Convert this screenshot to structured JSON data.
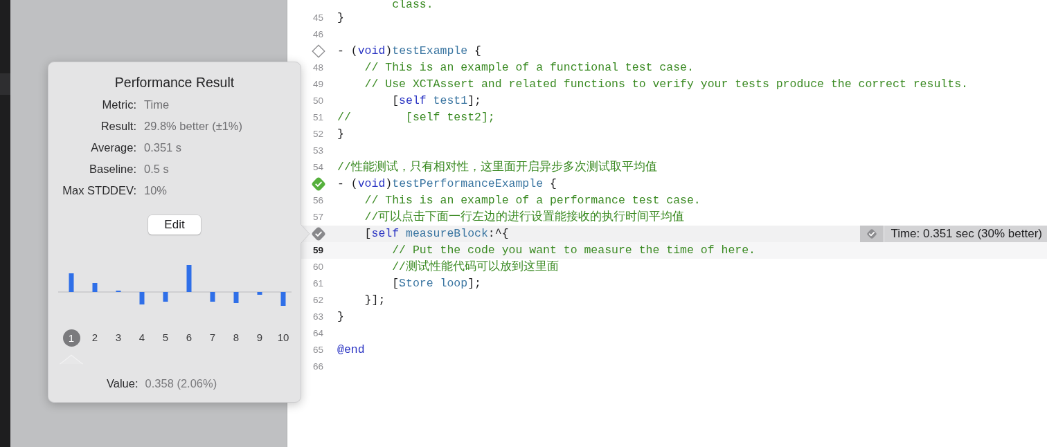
{
  "popover": {
    "title": "Performance Result",
    "stats": [
      {
        "label": "Metric:",
        "value": "Time"
      },
      {
        "label": "Result:",
        "value": "29.8% better (±1%)"
      },
      {
        "label": "Average:",
        "value": "0.351 s"
      },
      {
        "label": "Baseline:",
        "value": "0.5 s"
      },
      {
        "label": "Max STDDEV:",
        "value": "10%"
      }
    ],
    "edit_button": "Edit",
    "iterations": [
      {
        "label": "1",
        "selected": true
      },
      {
        "label": "2",
        "selected": false
      },
      {
        "label": "3",
        "selected": false
      },
      {
        "label": "4",
        "selected": false
      },
      {
        "label": "5",
        "selected": false
      },
      {
        "label": "6",
        "selected": false
      },
      {
        "label": "7",
        "selected": false
      },
      {
        "label": "8",
        "selected": false
      },
      {
        "label": "9",
        "selected": false
      },
      {
        "label": "10",
        "selected": false
      }
    ],
    "value": {
      "label": "Value:",
      "text": "0.358 (2.06%)"
    }
  },
  "editor": {
    "lines": [
      {
        "kind": "numbered",
        "tokens": [
          {
            "text": "        class.",
            "kind": "comment"
          }
        ]
      },
      {
        "kind": "numbered",
        "number": "45",
        "current": false,
        "tokens": [
          {
            "text": "}",
            "kind": "plain"
          }
        ]
      },
      {
        "kind": "numbered",
        "number": "46",
        "current": false
      },
      {
        "kind": "untested",
        "tokens": [
          {
            "text": "- (",
            "kind": "plain"
          },
          {
            "text": "void",
            "kind": "keyword"
          },
          {
            "text": ")",
            "kind": "plain"
          },
          {
            "text": "testExample",
            "kind": "identifier"
          },
          {
            "text": " {",
            "kind": "plain"
          }
        ]
      },
      {
        "kind": "numbered",
        "number": "48",
        "current": false,
        "tokens": [
          {
            "text": "    // This is an example of a functional test case.",
            "kind": "comment"
          }
        ]
      },
      {
        "kind": "numbered",
        "number": "49",
        "current": false,
        "tokens": [
          {
            "text": "    // Use XCTAssert and related functions to verify your tests produce the correct results.",
            "kind": "comment"
          }
        ]
      },
      {
        "kind": "numbered",
        "number": "50",
        "current": false,
        "tokens": [
          {
            "text": "        [",
            "kind": "plain"
          },
          {
            "text": "self",
            "kind": "keyword"
          },
          {
            "text": " test1",
            "kind": "identifier"
          },
          {
            "text": "];",
            "kind": "plain"
          }
        ]
      },
      {
        "kind": "numbered",
        "number": "51",
        "current": false,
        "tokens": [
          {
            "text": "//        [self test2];",
            "kind": "comment"
          }
        ]
      },
      {
        "kind": "numbered",
        "number": "52",
        "current": false,
        "tokens": [
          {
            "text": "}",
            "kind": "plain"
          }
        ]
      },
      {
        "kind": "numbered",
        "number": "53",
        "current": false
      },
      {
        "kind": "numbered",
        "number": "54",
        "current": false,
        "tokens": [
          {
            "text": "//性能测试，只有相对性，这里面开启异步多次测试取平均值",
            "kind": "comment"
          }
        ]
      },
      {
        "kind": "passed",
        "tokens": [
          {
            "text": "- (",
            "kind": "plain"
          },
          {
            "text": "void",
            "kind": "keyword"
          },
          {
            "text": ")",
            "kind": "plain"
          },
          {
            "text": "testPerformanceExample",
            "kind": "identifier"
          },
          {
            "text": " {",
            "kind": "plain"
          }
        ]
      },
      {
        "kind": "numbered",
        "number": "56",
        "current": false,
        "tokens": [
          {
            "text": "    // This is an example of a performance test case.",
            "kind": "comment"
          }
        ]
      },
      {
        "kind": "numbered",
        "number": "57",
        "current": false,
        "tokens": [
          {
            "text": "    //可以点击下面一行左边的进行设置能接收的执行时间平均值",
            "kind": "comment"
          }
        ]
      },
      {
        "kind": "measured",
        "tokens": [
          {
            "text": "    [",
            "kind": "plain"
          },
          {
            "text": "self",
            "kind": "keyword"
          },
          {
            "text": " measureBlock",
            "kind": "identifier"
          },
          {
            "text": ":^{",
            "kind": "plain"
          }
        ],
        "annotation": {
          "text": "Time: 0.351 sec (30% better)"
        }
      },
      {
        "kind": "numbered",
        "number": "59",
        "current": true,
        "tokens": [
          {
            "text": "        // Put the code you want to measure the time of here.",
            "kind": "comment"
          }
        ]
      },
      {
        "kind": "numbered",
        "number": "60",
        "current": false,
        "tokens": [
          {
            "text": "        //测试性能代码可以放到这里面",
            "kind": "comment"
          }
        ]
      },
      {
        "kind": "numbered",
        "number": "61",
        "current": false,
        "tokens": [
          {
            "text": "        [",
            "kind": "plain"
          },
          {
            "text": "Store",
            "kind": "identifier"
          },
          {
            "text": " loop",
            "kind": "identifier"
          },
          {
            "text": "];",
            "kind": "plain"
          }
        ]
      },
      {
        "kind": "numbered",
        "number": "62",
        "current": false,
        "tokens": [
          {
            "text": "    }];",
            "kind": "plain"
          }
        ]
      },
      {
        "kind": "numbered",
        "number": "63",
        "current": false,
        "tokens": [
          {
            "text": "}",
            "kind": "plain"
          }
        ]
      },
      {
        "kind": "numbered",
        "number": "64",
        "current": false
      },
      {
        "kind": "numbered",
        "number": "65",
        "current": false,
        "tokens": [
          {
            "text": "@end",
            "kind": "keyword"
          }
        ]
      },
      {
        "kind": "numbered",
        "number": "66",
        "current": false
      }
    ]
  }
}
